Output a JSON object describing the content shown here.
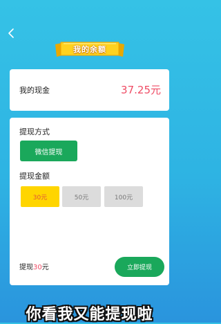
{
  "header": {
    "back_icon": "chevron-left-icon",
    "title": "我的余额"
  },
  "balance": {
    "label": "我的现金",
    "value": "37.25元"
  },
  "withdraw": {
    "method_label": "提现方式",
    "method_button": "微信提现",
    "amount_label": "提现金额",
    "options": [
      "30元",
      "50元",
      "100元"
    ],
    "selected_option": "30元",
    "summary_prefix": "提现",
    "summary_amount": "30",
    "summary_unit": "元",
    "submit_label": "立即提现"
  },
  "caption": "你看我又能提现啦",
  "colors": {
    "background_top": "#35c2e6",
    "accent_green": "#1aa85b",
    "price_red": "#ef4b64",
    "selected_yellow": "#ffd500",
    "banner_yellow": "#ffd21f"
  }
}
